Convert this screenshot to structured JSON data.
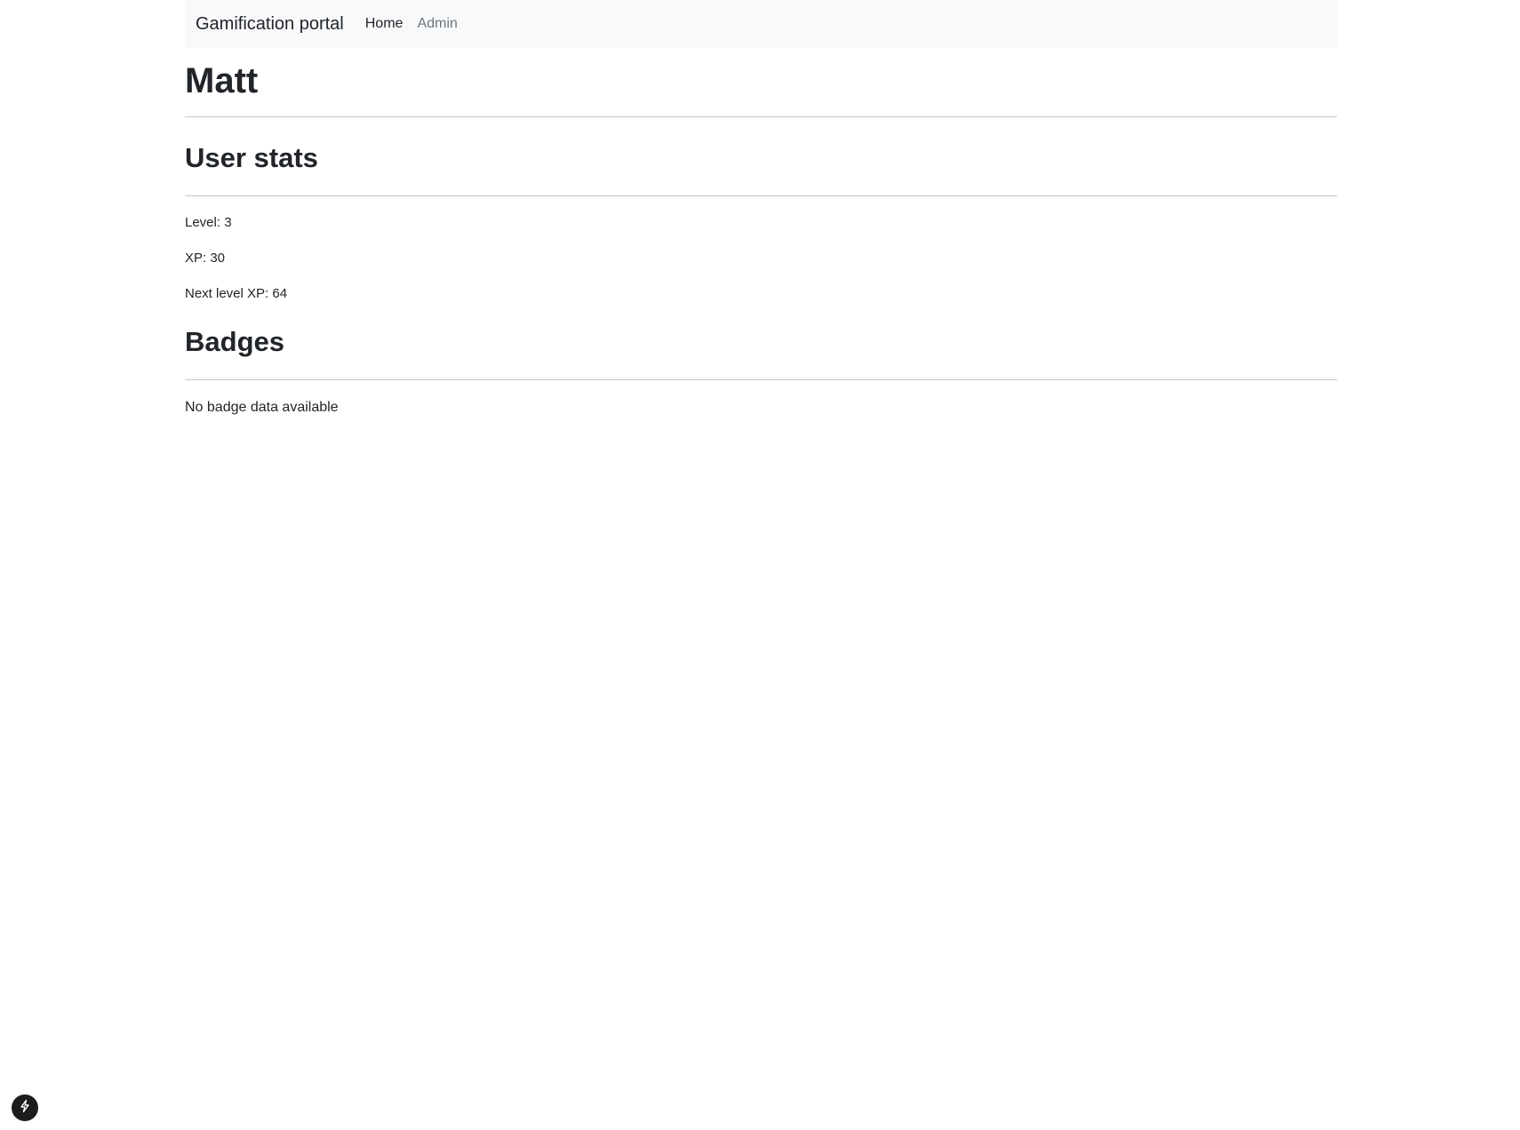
{
  "navbar": {
    "brand": "Gamification portal",
    "links": [
      {
        "label": "Home",
        "active": true
      },
      {
        "label": "Admin",
        "active": false
      }
    ]
  },
  "user": {
    "name": "Matt"
  },
  "stats": {
    "title": "User stats",
    "level": "Level: 3",
    "xp": "XP: 30",
    "next_level_xp": "Next level XP: 64"
  },
  "badges": {
    "title": "Badges",
    "empty_message": "No badge data available"
  },
  "floating_button": {
    "icon": "lightning-icon"
  },
  "colors": {
    "navbar_bg": "#f8f9fa",
    "text": "#212529",
    "muted_link": "#6c757d",
    "fab_bg": "#1c1c1c"
  }
}
